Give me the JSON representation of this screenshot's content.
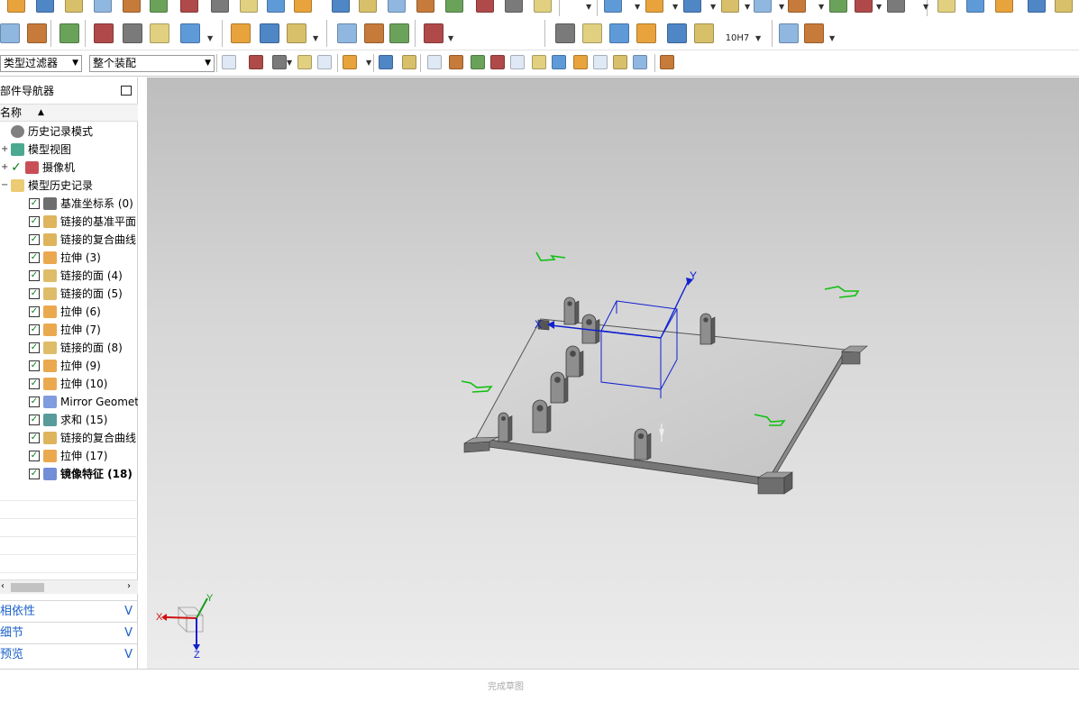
{
  "filters": {
    "type_filter": "类型过滤器",
    "scope_filter": "整个装配"
  },
  "toolbar": {
    "fit_label": "10H7"
  },
  "navigator": {
    "title": "部件导航器",
    "column_header": "名称",
    "sort_icon": "sort-up-icon",
    "items": [
      {
        "label": "历史记录模式",
        "icon": "clock-icon",
        "checked": false
      },
      {
        "label": "模型视图",
        "icon": "model-views-icon",
        "checked": false
      },
      {
        "label": "摄像机",
        "icon": "camera-icon",
        "checked": true
      },
      {
        "label": "模型历史记录",
        "icon": "folder-icon",
        "checked": false
      },
      {
        "label": "基准坐标系 (0)",
        "icon": "datum-csys-icon",
        "checked": true
      },
      {
        "label": "链接的基准平面",
        "icon": "linked-plane-icon",
        "checked": true
      },
      {
        "label": "链接的复合曲线",
        "icon": "linked-curve-icon",
        "checked": true
      },
      {
        "label": "拉伸 (3)",
        "icon": "extrude-icon",
        "checked": true
      },
      {
        "label": "链接的面 (4)",
        "icon": "linked-face-icon",
        "checked": true
      },
      {
        "label": "链接的面 (5)",
        "icon": "linked-face-icon",
        "checked": true
      },
      {
        "label": "拉伸 (6)",
        "icon": "extrude-icon",
        "checked": true
      },
      {
        "label": "拉伸 (7)",
        "icon": "extrude-icon",
        "checked": true
      },
      {
        "label": "链接的面 (8)",
        "icon": "linked-face-icon",
        "checked": true
      },
      {
        "label": "拉伸 (9)",
        "icon": "extrude-icon",
        "checked": true
      },
      {
        "label": "拉伸 (10)",
        "icon": "extrude-icon",
        "checked": true
      },
      {
        "label": "Mirror Geometry",
        "icon": "mirror-geometry-icon",
        "checked": true
      },
      {
        "label": "求和 (15)",
        "icon": "unite-icon",
        "checked": true
      },
      {
        "label": "链接的复合曲线",
        "icon": "linked-curve-icon",
        "checked": true
      },
      {
        "label": "拉伸 (17)",
        "icon": "extrude-icon",
        "checked": true
      },
      {
        "label": "镜像特征 (18)",
        "icon": "mirror-feature-icon",
        "checked": true
      }
    ],
    "panels": [
      {
        "label": "相依性"
      },
      {
        "label": "细节"
      },
      {
        "label": "预览"
      }
    ]
  },
  "viewport": {
    "axis_x": "X",
    "axis_y": "Y",
    "axis_z": "Z"
  },
  "sketch_toolbar": {
    "finish_sketch": "完成草图"
  },
  "colors": {
    "link_blue": "#1a60c8",
    "check_green": "#0a7d1b",
    "csys_blue": "#1020d0",
    "hidden_green": "#10c010",
    "part_gray": "#8e8e8e"
  }
}
